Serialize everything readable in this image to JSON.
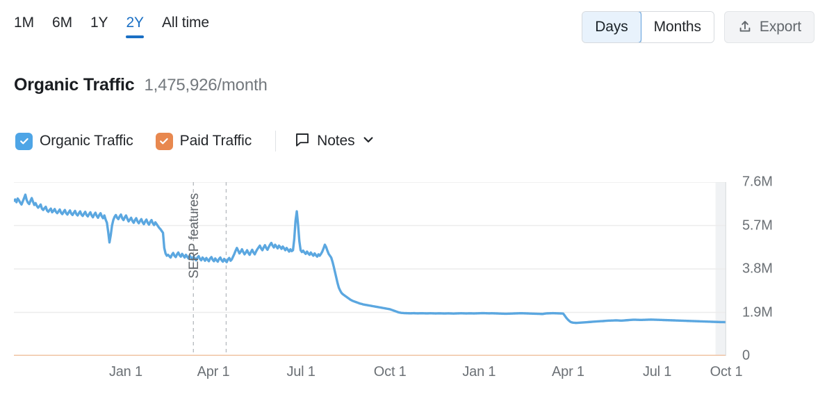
{
  "time_ranges": [
    {
      "label": "1M",
      "active": false
    },
    {
      "label": "6M",
      "active": false
    },
    {
      "label": "1Y",
      "active": false
    },
    {
      "label": "2Y",
      "active": true
    },
    {
      "label": "All time",
      "active": false
    }
  ],
  "granularity": {
    "days_label": "Days",
    "months_label": "Months",
    "selected": "Days"
  },
  "export": {
    "label": "Export",
    "icon": "upload-icon"
  },
  "heading": {
    "title": "Organic Traffic",
    "value": "1,475,926/month"
  },
  "legend": {
    "organic": {
      "label": "Organic Traffic",
      "checked": true,
      "color": "#4ea5e6"
    },
    "paid": {
      "label": "Paid Traffic",
      "checked": true,
      "color": "#e8884f"
    },
    "notes": {
      "label": "Notes",
      "icon": "note-bubble-icon",
      "chevron": "chevron-down-icon"
    }
  },
  "colors": {
    "organic_line": "#5ba7e0",
    "paid_line": "#f0c3a3",
    "accent_blue": "#1a6fc4",
    "grid": "#ececec",
    "axis_text": "#6b7075",
    "marker_dash": "#b9bdc1",
    "forecast_band": "#f0f2f4"
  },
  "chart_data": {
    "type": "line",
    "title": "Organic Traffic",
    "xlabel": "",
    "ylabel": "",
    "grid": true,
    "legend_position": "top-left",
    "ylim": [
      0,
      7600000
    ],
    "yticks": [
      7600000,
      5700000,
      3800000,
      1900000,
      0
    ],
    "ytick_labels": [
      "7.6M",
      "5.7M",
      "3.8M",
      "1.9M",
      "0"
    ],
    "xtick_labels": [
      "Jan 1",
      "Apr 1",
      "Jul 1",
      "Oct 1",
      "Jan 1",
      "Apr 1",
      "Jul 1",
      "Oct 1"
    ],
    "xtick_positions": [
      0.157,
      0.28,
      0.403,
      0.528,
      0.653,
      0.778,
      0.903,
      1.0
    ],
    "annotations": [
      {
        "label": "SERP features",
        "x": 0.243,
        "orientation": "vertical"
      }
    ],
    "markers": [
      {
        "type": "dashed-vline",
        "x": 0.252
      },
      {
        "type": "dashed-vline",
        "x": 0.298
      }
    ],
    "shaded_bands": [
      {
        "type": "forecast",
        "x_start": 0.985,
        "x_end": 1.0
      }
    ],
    "series": [
      {
        "name": "Organic Traffic",
        "color": "#5ba7e0",
        "values": [
          6780000,
          6840000,
          6720000,
          6880000,
          6800000,
          6700000,
          6620000,
          6760000,
          6900000,
          7050000,
          6820000,
          6700000,
          6640000,
          6780000,
          6900000,
          6740000,
          6600000,
          6680000,
          6560000,
          6480000,
          6540000,
          6620000,
          6440000,
          6380000,
          6460000,
          6520000,
          6360000,
          6300000,
          6380000,
          6440000,
          6280000,
          6340000,
          6420000,
          6300000,
          6240000,
          6320000,
          6400000,
          6260000,
          6200000,
          6300000,
          6380000,
          6240000,
          6180000,
          6280000,
          6360000,
          6220000,
          6160000,
          6260000,
          6340000,
          6200000,
          6140000,
          6240000,
          6320000,
          6180000,
          6120000,
          6220000,
          6300000,
          6160000,
          6100000,
          6200000,
          6280000,
          6140000,
          6060000,
          6180000,
          6260000,
          6120000,
          6040000,
          6160000,
          6240000,
          6100000,
          6020000,
          6140000,
          5960000,
          5820000,
          5420000,
          4960000,
          5280000,
          5700000,
          5940000,
          6080000,
          6160000,
          6040000,
          5980000,
          6100000,
          6180000,
          6020000,
          5940000,
          6060000,
          6140000,
          6000000,
          5880000,
          5960000,
          6040000,
          5900000,
          5820000,
          5940000,
          6020000,
          5880000,
          5800000,
          5900000,
          5980000,
          5840000,
          5760000,
          5880000,
          5960000,
          5820000,
          5740000,
          5860000,
          5940000,
          5800000,
          5720000,
          5840000,
          5760000,
          5680000,
          5600000,
          5540000,
          5460000,
          5380000,
          4720000,
          4480000,
          4380000,
          4420000,
          4360000,
          4300000,
          4420000,
          4500000,
          4380000,
          4320000,
          4440000,
          4520000,
          4400000,
          4340000,
          4460000,
          4380000,
          4300000,
          4420000,
          4340000,
          4260000,
          4380000,
          4300000,
          4220000,
          4340000,
          4260000,
          4180000,
          4300000,
          4360000,
          4240000,
          4180000,
          4300000,
          4240000,
          4160000,
          4280000,
          4200000,
          4140000,
          4260000,
          4320000,
          4200000,
          4140000,
          4260000,
          4180000,
          4120000,
          4240000,
          4300000,
          4180000,
          4120000,
          4240000,
          4160000,
          4100000,
          4220000,
          4280000,
          4160000,
          4220000,
          4340000,
          4460000,
          4600000,
          4720000,
          4600000,
          4480000,
          4560000,
          4660000,
          4540000,
          4440000,
          4520000,
          4620000,
          4500000,
          4420000,
          4540000,
          4640000,
          4520000,
          4440000,
          4560000,
          4660000,
          4740000,
          4820000,
          4700000,
          4620000,
          4740000,
          4840000,
          4720000,
          4640000,
          4760000,
          4860000,
          4940000,
          4820000,
          4740000,
          4860000,
          4780000,
          4700000,
          4820000,
          4760000,
          4680000,
          4780000,
          4700000,
          4620000,
          4720000,
          4640000,
          4560000,
          4660000,
          4580000,
          4620000,
          5100000,
          5900000,
          6320000,
          5740000,
          5020000,
          4620000,
          4540000,
          4600000,
          4520000,
          4460000,
          4560000,
          4480000,
          4420000,
          4520000,
          4440000,
          4380000,
          4480000,
          4400000,
          4340000,
          4440000,
          4380000,
          4460000,
          4560000,
          4700000,
          4860000,
          4760000,
          4600000,
          4460000,
          4380000,
          4300000,
          4120000,
          3900000,
          3660000,
          3420000,
          3180000,
          2980000,
          2860000,
          2760000,
          2700000,
          2660000,
          2620000,
          2580000,
          2540000,
          2500000,
          2460000,
          2430000,
          2400000,
          2380000,
          2360000,
          2340000,
          2320000,
          2300000,
          2280000,
          2270000,
          2250000,
          2240000,
          2230000,
          2220000,
          2210000,
          2200000,
          2190000,
          2180000,
          2170000,
          2160000,
          2150000,
          2140000,
          2130000,
          2120000,
          2110000,
          2100000,
          2090000,
          2080000,
          2070000,
          2060000,
          2050000,
          2040000,
          2020000,
          2000000,
          1980000,
          1960000,
          1940000,
          1920000,
          1900000,
          1890000,
          1880000,
          1875000,
          1870000,
          1868000,
          1866000,
          1864000,
          1862000,
          1860000,
          1862000,
          1864000,
          1866000,
          1862000,
          1860000,
          1858000,
          1860000,
          1862000,
          1864000,
          1862000,
          1860000,
          1858000,
          1856000,
          1858000,
          1860000,
          1862000,
          1860000,
          1858000,
          1856000,
          1854000,
          1856000,
          1858000,
          1860000,
          1858000,
          1856000,
          1854000,
          1852000,
          1854000,
          1856000,
          1858000,
          1856000,
          1854000,
          1852000,
          1850000,
          1852000,
          1854000,
          1856000,
          1858000,
          1860000,
          1862000,
          1860000,
          1858000,
          1856000,
          1854000,
          1856000,
          1858000,
          1860000,
          1858000,
          1856000,
          1854000,
          1856000,
          1858000,
          1860000,
          1862000,
          1864000,
          1866000,
          1868000,
          1866000,
          1864000,
          1862000,
          1860000,
          1858000,
          1860000,
          1862000,
          1860000,
          1858000,
          1856000,
          1854000,
          1852000,
          1850000,
          1848000,
          1846000,
          1844000,
          1842000,
          1840000,
          1842000,
          1844000,
          1846000,
          1848000,
          1850000,
          1852000,
          1854000,
          1856000,
          1858000,
          1860000,
          1862000,
          1864000,
          1862000,
          1860000,
          1858000,
          1856000,
          1854000,
          1852000,
          1850000,
          1848000,
          1846000,
          1844000,
          1842000,
          1840000,
          1838000,
          1836000,
          1834000,
          1832000,
          1830000,
          1840000,
          1850000,
          1855000,
          1858000,
          1860000,
          1862000,
          1864000,
          1866000,
          1864000,
          1862000,
          1860000,
          1858000,
          1856000,
          1854000,
          1852000,
          1850000,
          1780000,
          1700000,
          1630000,
          1570000,
          1520000,
          1480000,
          1460000,
          1450000,
          1445000,
          1440000,
          1442000,
          1446000,
          1450000,
          1454000,
          1458000,
          1462000,
          1466000,
          1470000,
          1474000,
          1478000,
          1482000,
          1486000,
          1490000,
          1494000,
          1498000,
          1502000,
          1506000,
          1510000,
          1514000,
          1518000,
          1520000,
          1524000,
          1528000,
          1532000,
          1536000,
          1540000,
          1542000,
          1544000,
          1546000,
          1548000,
          1550000,
          1552000,
          1548000,
          1544000,
          1540000,
          1542000,
          1546000,
          1550000,
          1554000,
          1558000,
          1562000,
          1566000,
          1570000,
          1574000,
          1578000,
          1580000,
          1578000,
          1576000,
          1574000,
          1572000,
          1570000,
          1572000,
          1574000,
          1576000,
          1578000,
          1580000,
          1582000,
          1584000,
          1586000,
          1584000,
          1582000,
          1580000,
          1578000,
          1576000,
          1574000,
          1572000,
          1570000,
          1568000,
          1566000,
          1564000,
          1562000,
          1560000,
          1558000,
          1556000,
          1554000,
          1552000,
          1550000,
          1548000,
          1546000,
          1544000,
          1542000,
          1540000,
          1538000,
          1536000,
          1534000,
          1532000,
          1530000,
          1528000,
          1526000,
          1524000,
          1522000,
          1520000,
          1518000,
          1516000,
          1514000,
          1512000,
          1510000,
          1508000,
          1506000,
          1504000,
          1502000,
          1500000,
          1498000,
          1496000,
          1494000,
          1492000,
          1490000,
          1488000,
          1486000,
          1484000,
          1482000,
          1480000,
          1478000,
          1476000,
          1475926,
          1475000,
          1474000,
          1473000
        ]
      },
      {
        "name": "Paid Traffic",
        "color": "#f0c3a3",
        "values": [
          0,
          0,
          0,
          0,
          0,
          0,
          0,
          0,
          0,
          0,
          0,
          0,
          0,
          0,
          0,
          0,
          0,
          0,
          0,
          0,
          0,
          0,
          0,
          0,
          0,
          0,
          0,
          0,
          0,
          0,
          0,
          0,
          0,
          0,
          0,
          0,
          0,
          0,
          0,
          0
        ]
      }
    ]
  }
}
